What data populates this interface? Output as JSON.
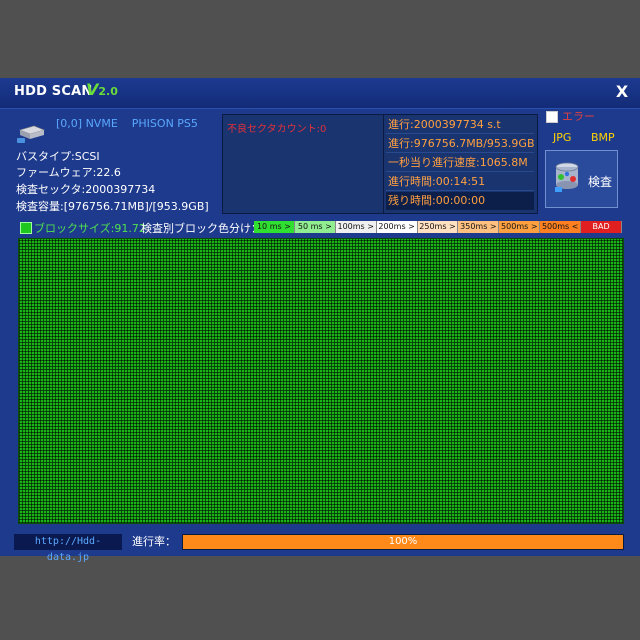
{
  "app": {
    "title": "HDD SCAN",
    "version_major": "V",
    "version_minor": "2.0",
    "close_label": "X"
  },
  "drive": {
    "id": "[0,0]",
    "type": "NVME",
    "model": "PHISON PS5",
    "bus": "バスタイプ:SCSI",
    "firmware": "ファームウェア:22.6",
    "sectors": "検査セックタ:2000397734",
    "capacity": "検査容量:[976756.71MB]/[953.9GB]",
    "icon": "hard-drive-icon"
  },
  "error_panel": {
    "label": "不良セクタカウント:0"
  },
  "progress_panel": {
    "lines": [
      "進行:2000397734 s.t",
      "進行:976756.7MB/953.9GB",
      "一秒当り進行速度:1065.8M",
      "進行時間:00:14:51",
      "残り時間:00:00:00"
    ]
  },
  "options": {
    "error_checkbox_label": "エラー",
    "error_checked": false,
    "jpg_label": "JPG",
    "bmp_label": "BMP"
  },
  "scan_button": {
    "label": "検査",
    "icon": "database-scan-icon"
  },
  "legend": {
    "block_size": "ブロックサイズ:91.72",
    "title": "検査別ブロック色分け：",
    "items": [
      {
        "label": "10 ms >",
        "color": "#30e030"
      },
      {
        "label": "50 ms >",
        "color": "#90ee90"
      },
      {
        "label": "100ms >",
        "color": "#f0f0f0"
      },
      {
        "label": "200ms >",
        "color": "#ffffff"
      },
      {
        "label": "250ms >",
        "color": "#ffe0c0"
      },
      {
        "label": "350ms >",
        "color": "#ffc080"
      },
      {
        "label": "500ms >",
        "color": "#ffa040"
      },
      {
        "label": "500ms <",
        "color": "#ff8020"
      },
      {
        "label": "BAD",
        "color": "#e02020"
      }
    ]
  },
  "colors": {
    "grid_block": "#18b418",
    "progress_fill": "#ff8a1a"
  },
  "footer": {
    "website": "http://Hdd-data.jp",
    "progress_label": "進行率：",
    "progress_value": 1.0,
    "progress_text": "100%"
  }
}
